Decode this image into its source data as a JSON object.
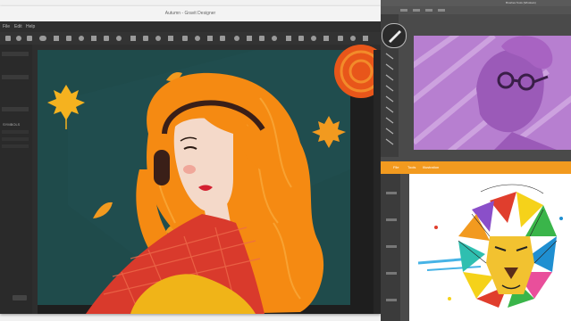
{
  "main_window": {
    "title": "Autumn - Gravit Designer",
    "menu_items": [
      "File",
      "Edit",
      "Help"
    ],
    "panel_label": "SYMBOLS"
  },
  "brush_window": {
    "title": "Brushes Tools (Windows)"
  },
  "vector_window": {
    "menu_items": [
      "File",
      "Tools",
      "Illustration"
    ]
  },
  "colors": {
    "canvas_bg": "#1f4b4b",
    "hair": "#f58a12",
    "scarf": "#d93a2c",
    "accent_orange": "#f29a1f",
    "purple": "#b77fd0"
  }
}
